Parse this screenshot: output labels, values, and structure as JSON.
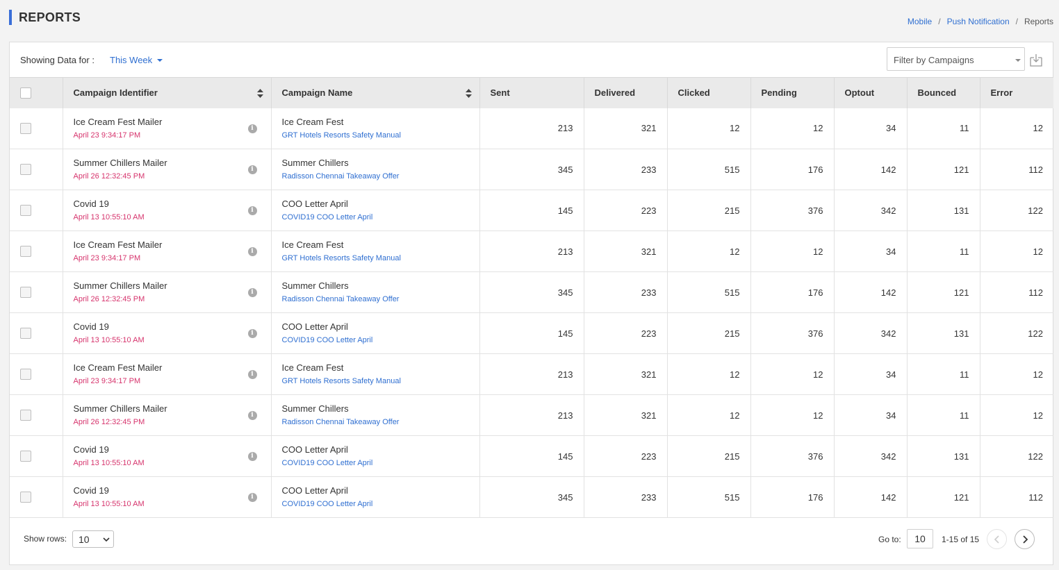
{
  "header": {
    "title": "REPORTS",
    "breadcrumb": [
      "Mobile",
      "Push Notification",
      "Reports"
    ]
  },
  "toolbar": {
    "showing_label": "Showing Data for :",
    "period": "This Week",
    "filter_placeholder": "Filter by Campaigns"
  },
  "table": {
    "columns": [
      "Campaign Identifier",
      "Campaign Name",
      "Sent",
      "Delivered",
      "Clicked",
      "Pending",
      "Optout",
      "Bounced",
      "Error"
    ],
    "rows": [
      {
        "identifier": "Ice Cream Fest Mailer",
        "date": "April 23 9:34:17 PM",
        "name": "Ice Cream Fest",
        "subtitle": "GRT Hotels Resorts Safety Manual",
        "sent": "213",
        "delivered": "321",
        "clicked": "12",
        "pending": "12",
        "optout": "34",
        "bounced": "11",
        "error": "12"
      },
      {
        "identifier": "Summer Chillers Mailer",
        "date": "April 26 12:32:45 PM",
        "name": "Summer Chillers",
        "subtitle": "Radisson Chennai Takeaway Offer",
        "sent": "345",
        "delivered": "233",
        "clicked": "515",
        "pending": "176",
        "optout": "142",
        "bounced": "121",
        "error": "112"
      },
      {
        "identifier": "Covid 19",
        "date": "April 13 10:55:10 AM",
        "name": "COO Letter April",
        "subtitle": "COVID19 COO Letter April",
        "sent": "145",
        "delivered": "223",
        "clicked": "215",
        "pending": "376",
        "optout": "342",
        "bounced": "131",
        "error": "122"
      },
      {
        "identifier": "Ice Cream Fest Mailer",
        "date": "April 23 9:34:17 PM",
        "name": "Ice Cream Fest",
        "subtitle": "GRT Hotels Resorts Safety Manual",
        "sent": "213",
        "delivered": "321",
        "clicked": "12",
        "pending": "12",
        "optout": "34",
        "bounced": "11",
        "error": "12"
      },
      {
        "identifier": "Summer Chillers Mailer",
        "date": "April 26 12:32:45 PM",
        "name": "Summer Chillers",
        "subtitle": "Radisson Chennai Takeaway Offer",
        "sent": "345",
        "delivered": "233",
        "clicked": "515",
        "pending": "176",
        "optout": "142",
        "bounced": "121",
        "error": "112"
      },
      {
        "identifier": "Covid 19",
        "date": "April 13 10:55:10 AM",
        "name": "COO Letter April",
        "subtitle": "COVID19 COO Letter April",
        "sent": "145",
        "delivered": "223",
        "clicked": "215",
        "pending": "376",
        "optout": "342",
        "bounced": "131",
        "error": "122"
      },
      {
        "identifier": "Ice Cream Fest Mailer",
        "date": "April 23 9:34:17 PM",
        "name": "Ice Cream Fest",
        "subtitle": "GRT Hotels Resorts Safety Manual",
        "sent": "213",
        "delivered": "321",
        "clicked": "12",
        "pending": "12",
        "optout": "34",
        "bounced": "11",
        "error": "12"
      },
      {
        "identifier": "Summer Chillers Mailer",
        "date": "April 26 12:32:45 PM",
        "name": "Summer Chillers",
        "subtitle": "Radisson Chennai Takeaway Offer",
        "sent": "213",
        "delivered": "321",
        "clicked": "12",
        "pending": "12",
        "optout": "34",
        "bounced": "11",
        "error": "12"
      },
      {
        "identifier": "Covid 19",
        "date": "April 13 10:55:10 AM",
        "name": "COO Letter April",
        "subtitle": "COVID19 COO Letter April",
        "sent": "145",
        "delivered": "223",
        "clicked": "215",
        "pending": "376",
        "optout": "342",
        "bounced": "131",
        "error": "122"
      },
      {
        "identifier": "Covid 19",
        "date": "April 13 10:55:10 AM",
        "name": "COO Letter April",
        "subtitle": "COVID19 COO Letter April",
        "sent": "345",
        "delivered": "233",
        "clicked": "515",
        "pending": "176",
        "optout": "142",
        "bounced": "121",
        "error": "112"
      }
    ]
  },
  "footer": {
    "show_rows_label": "Show rows:",
    "rows_value": "10",
    "goto_label": "Go to:",
    "goto_value": "10",
    "page_info": "1-15 of 15"
  },
  "icons": {
    "info": "info-icon",
    "sort": "sort-icon",
    "download": "download-icon",
    "prev": "chevron-left-icon",
    "next": "chevron-right-icon"
  },
  "colors": {
    "accent": "#2f6fd1",
    "title_bar": "#3a6fd8",
    "date": "#d6336c",
    "header_bg": "#eaeaea"
  }
}
